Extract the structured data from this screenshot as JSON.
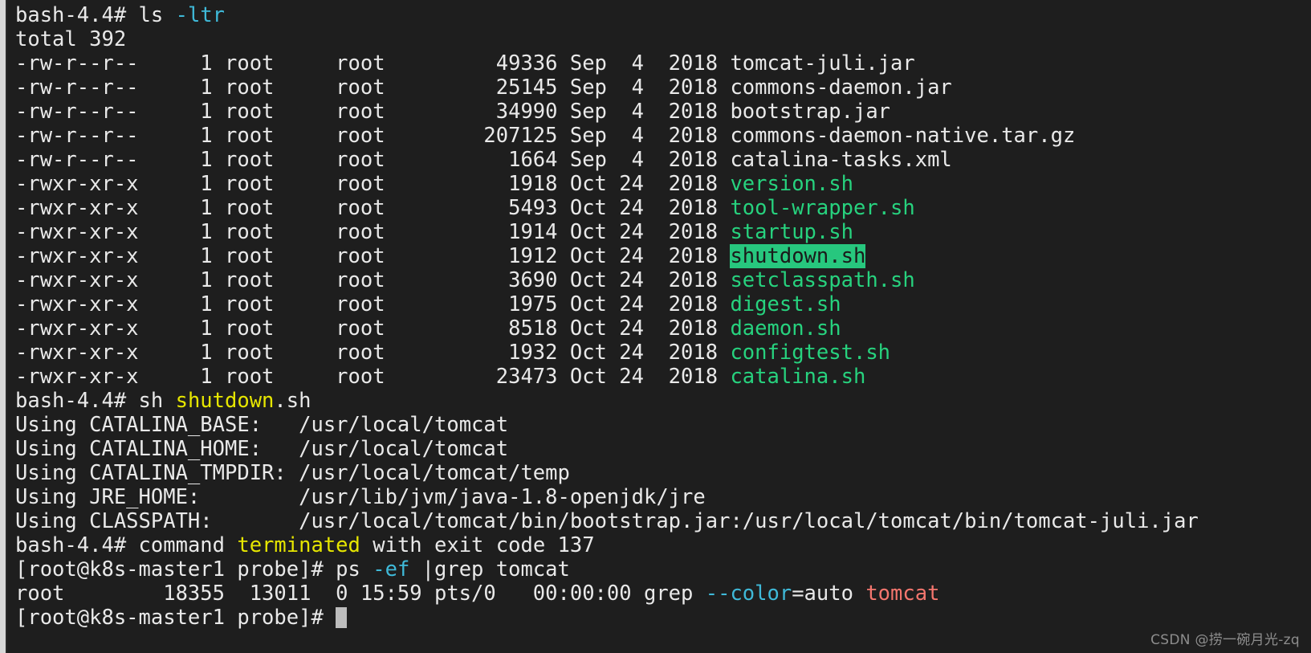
{
  "terminal": {
    "colors": {
      "background": "#1e1e1e",
      "foreground": "#e9e9e9",
      "cyan": "#3fb9d8",
      "green": "#27d27e",
      "yellow": "#e6e600",
      "red": "#f4766e",
      "highlight_bg": "#27c77e",
      "highlight_fg": "#1a1a1a",
      "cursor": "#bdbdbd",
      "edge_strip": "#d8d8d8"
    },
    "prompts": {
      "container": "bash-4.4#",
      "host": "[root@k8s-master1 probe]#"
    },
    "commands": {
      "ls": "ls",
      "ls_flags": "-ltr",
      "run_shutdown_sh": "sh ",
      "run_shutdown_name": "shutdown",
      "run_shutdown_ext": ".sh",
      "ps": "ps ",
      "ps_flags": "-ef",
      "ps_pipe_grep": " |grep tomcat"
    },
    "ls_output": {
      "total_label": "total 392",
      "columns": [
        "perms",
        "links",
        "owner",
        "group",
        "size",
        "month",
        "day",
        "year",
        "name"
      ],
      "rows": [
        {
          "perms": "-rw-r--r--",
          "links": "1",
          "owner": "root",
          "group": "root",
          "size": "49336",
          "month": "Sep",
          "day": "4",
          "year": "2018",
          "name": "tomcat-juli.jar",
          "color": "white",
          "highlight": false
        },
        {
          "perms": "-rw-r--r--",
          "links": "1",
          "owner": "root",
          "group": "root",
          "size": "25145",
          "month": "Sep",
          "day": "4",
          "year": "2018",
          "name": "commons-daemon.jar",
          "color": "white",
          "highlight": false
        },
        {
          "perms": "-rw-r--r--",
          "links": "1",
          "owner": "root",
          "group": "root",
          "size": "34990",
          "month": "Sep",
          "day": "4",
          "year": "2018",
          "name": "bootstrap.jar",
          "color": "white",
          "highlight": false
        },
        {
          "perms": "-rw-r--r--",
          "links": "1",
          "owner": "root",
          "group": "root",
          "size": "207125",
          "month": "Sep",
          "day": "4",
          "year": "2018",
          "name": "commons-daemon-native.tar.gz",
          "color": "white",
          "highlight": false
        },
        {
          "perms": "-rw-r--r--",
          "links": "1",
          "owner": "root",
          "group": "root",
          "size": "1664",
          "month": "Sep",
          "day": "4",
          "year": "2018",
          "name": "catalina-tasks.xml",
          "color": "white",
          "highlight": false
        },
        {
          "perms": "-rwxr-xr-x",
          "links": "1",
          "owner": "root",
          "group": "root",
          "size": "1918",
          "month": "Oct",
          "day": "24",
          "year": "2018",
          "name": "version.sh",
          "color": "green",
          "highlight": false
        },
        {
          "perms": "-rwxr-xr-x",
          "links": "1",
          "owner": "root",
          "group": "root",
          "size": "5493",
          "month": "Oct",
          "day": "24",
          "year": "2018",
          "name": "tool-wrapper.sh",
          "color": "green",
          "highlight": false
        },
        {
          "perms": "-rwxr-xr-x",
          "links": "1",
          "owner": "root",
          "group": "root",
          "size": "1914",
          "month": "Oct",
          "day": "24",
          "year": "2018",
          "name": "startup.sh",
          "color": "green",
          "highlight": false
        },
        {
          "perms": "-rwxr-xr-x",
          "links": "1",
          "owner": "root",
          "group": "root",
          "size": "1912",
          "month": "Oct",
          "day": "24",
          "year": "2018",
          "name": "shutdown.sh",
          "color": "green",
          "highlight": true
        },
        {
          "perms": "-rwxr-xr-x",
          "links": "1",
          "owner": "root",
          "group": "root",
          "size": "3690",
          "month": "Oct",
          "day": "24",
          "year": "2018",
          "name": "setclasspath.sh",
          "color": "green",
          "highlight": false
        },
        {
          "perms": "-rwxr-xr-x",
          "links": "1",
          "owner": "root",
          "group": "root",
          "size": "1975",
          "month": "Oct",
          "day": "24",
          "year": "2018",
          "name": "digest.sh",
          "color": "green",
          "highlight": false
        },
        {
          "perms": "-rwxr-xr-x",
          "links": "1",
          "owner": "root",
          "group": "root",
          "size": "8518",
          "month": "Oct",
          "day": "24",
          "year": "2018",
          "name": "daemon.sh",
          "color": "green",
          "highlight": false
        },
        {
          "perms": "-rwxr-xr-x",
          "links": "1",
          "owner": "root",
          "group": "root",
          "size": "1932",
          "month": "Oct",
          "day": "24",
          "year": "2018",
          "name": "configtest.sh",
          "color": "green",
          "highlight": false
        },
        {
          "perms": "-rwxr-xr-x",
          "links": "1",
          "owner": "root",
          "group": "root",
          "size": "23473",
          "month": "Oct",
          "day": "24",
          "year": "2018",
          "name": "catalina.sh",
          "color": "green",
          "highlight": false
        }
      ]
    },
    "catalina_env": [
      {
        "label": "Using CATALINA_BASE:",
        "value": "/usr/local/tomcat"
      },
      {
        "label": "Using CATALINA_HOME:",
        "value": "/usr/local/tomcat"
      },
      {
        "label": "Using CATALINA_TMPDIR:",
        "value": "/usr/local/tomcat/temp"
      },
      {
        "label": "Using JRE_HOME:",
        "value": "/usr/lib/jvm/java-1.8-openjdk/jre"
      },
      {
        "label": "Using CLASSPATH:",
        "value": "/usr/local/tomcat/bin/bootstrap.jar:/usr/local/tomcat/bin/tomcat-juli.jar"
      }
    ],
    "terminated_msg": {
      "pre": "command ",
      "word": "terminated",
      "post": " with exit code 137"
    },
    "ps_output": {
      "user": "root",
      "pid": "18355",
      "ppid": "13011",
      "c": "0",
      "stime": "15:59",
      "tty": "pts/0",
      "time": "00:00:00",
      "cmd_name": "grep ",
      "cmd_flag": "--color",
      "cmd_flag_value": "=auto ",
      "cmd_arg": "tomcat"
    }
  },
  "watermark": "CSDN @捞一碗月光-zq"
}
